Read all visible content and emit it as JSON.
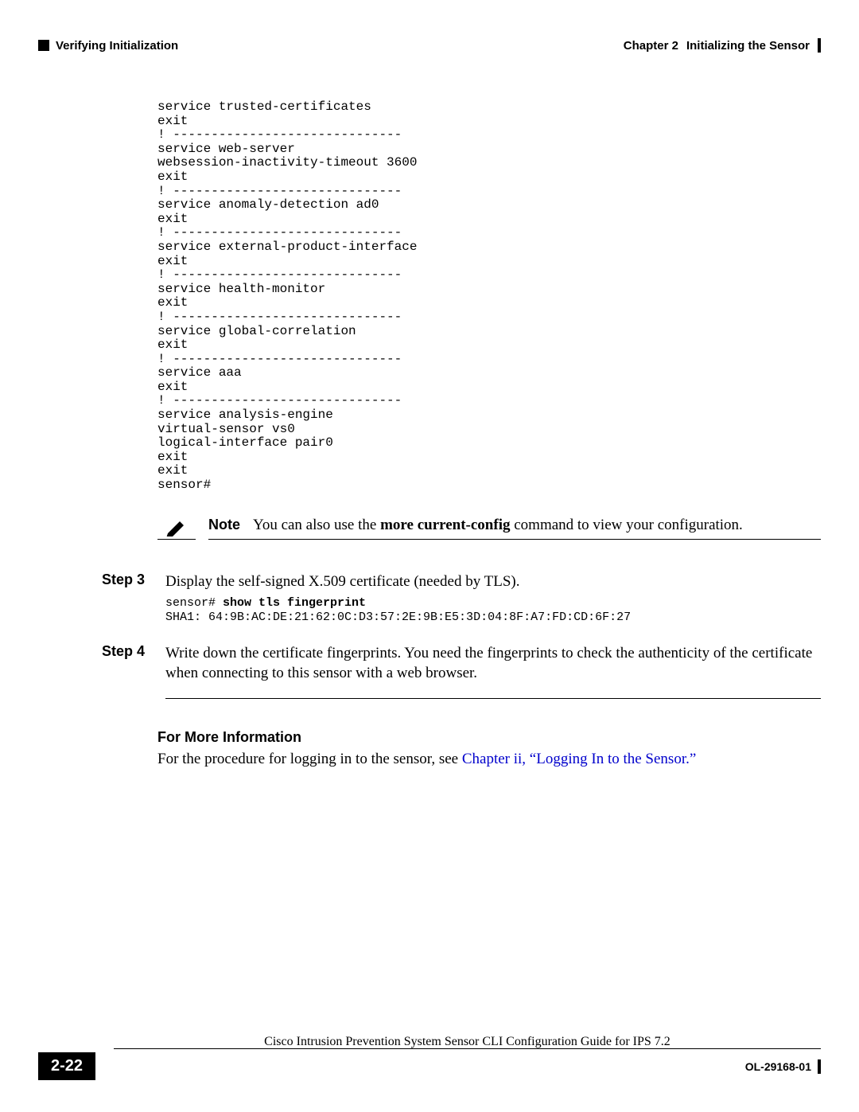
{
  "header": {
    "left": "Verifying Initialization",
    "chapter_label": "Chapter 2",
    "chapter_title": "Initializing the Sensor"
  },
  "cli_output": "service trusted-certificates\nexit\n! ------------------------------\nservice web-server\nwebsession-inactivity-timeout 3600\nexit\n! ------------------------------\nservice anomaly-detection ad0\nexit\n! ------------------------------\nservice external-product-interface\nexit\n! ------------------------------\nservice health-monitor\nexit\n! ------------------------------\nservice global-correlation\nexit\n! ------------------------------\nservice aaa\nexit\n! ------------------------------\nservice analysis-engine\nvirtual-sensor vs0\nlogical-interface pair0\nexit\nexit\nsensor#",
  "note": {
    "label": "Note",
    "prefix": "You can also use the ",
    "bold": "more current-config",
    "suffix": " command to view your configuration."
  },
  "steps": {
    "s3": {
      "label": "Step 3",
      "text": "Display the self-signed X.509 certificate (needed by TLS).",
      "cli_prompt": "sensor# ",
      "cli_cmd": "show tls fingerprint",
      "cli_out": "SHA1: 64:9B:AC:DE:21:62:0C:D3:57:2E:9B:E5:3D:04:8F:A7:FD:CD:6F:27"
    },
    "s4": {
      "label": "Step 4",
      "text": "Write down the certificate fingerprints. You need the fingerprints to check the authenticity of the certificate when connecting to this sensor with a web browser."
    }
  },
  "fmi": {
    "heading": "For More Information",
    "prefix": "For the procedure for logging in to the sensor, see ",
    "link": "Chapter ii, “Logging In to the Sensor.”"
  },
  "footer": {
    "guide": "Cisco Intrusion Prevention System Sensor CLI Configuration Guide for IPS 7.2",
    "page": "2-22",
    "doc": "OL-29168-01"
  }
}
